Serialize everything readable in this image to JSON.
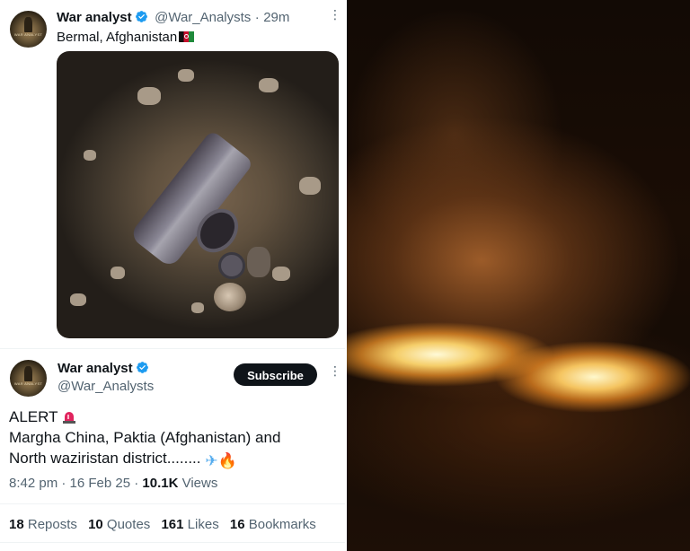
{
  "tweet1": {
    "author_name": "War analyst",
    "handle": "@War_Analysts",
    "separator": "·",
    "time": "29m",
    "text": "Bermal, Afghanistan",
    "flag_icon": "afghanistan-flag-icon"
  },
  "tweet2": {
    "author_name": "War analyst",
    "handle": "@War_Analysts",
    "subscribe_label": "Subscribe",
    "line1": "ALERT",
    "line2": "Margha China, Paktia (Afghanistan) and",
    "line3": "North waziristan district........",
    "meta_time": "8:42 pm · 16 Feb 25 · ",
    "views_count": "10.1K",
    "views_label": " Views",
    "stats": [
      {
        "count": "18",
        "label": "Reposts"
      },
      {
        "count": "10",
        "label": "Quotes"
      },
      {
        "count": "161",
        "label": "Likes"
      },
      {
        "count": "16",
        "label": "Bookmarks"
      }
    ]
  },
  "colors": {
    "verified": "#1d9bf0",
    "text": "#0f1419",
    "muted": "#536471",
    "subscribe_bg": "#0f1419"
  }
}
